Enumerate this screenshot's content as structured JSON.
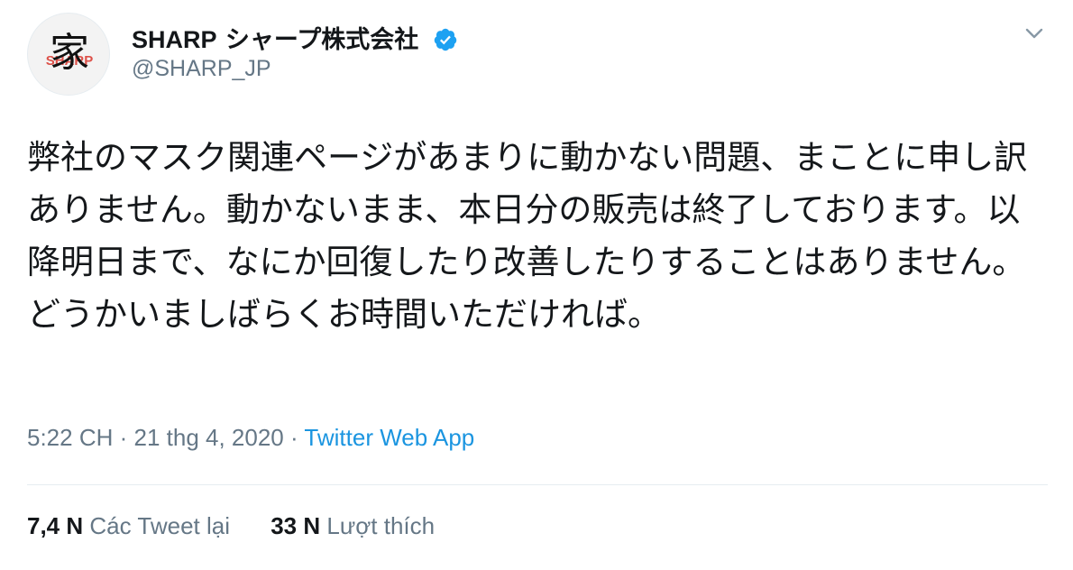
{
  "profile": {
    "display_name_latin": "SHARP",
    "display_name_jp": " シャープ株式会社",
    "handle": "@SHARP_JP",
    "avatar_kanji": "家",
    "avatar_brand": "SHARP",
    "verified": true,
    "verified_color": "#1da1f2"
  },
  "tweet": {
    "text": "弊社のマスク関連ページがあまりに動かない問題、まことに申し訳ありません。動かないまま、本日分の販売は終了しております。以降明日まで、なにか回復したり改善したりすることはありません。どうかいましばらくお時間いただければ。",
    "time": "5:22 CH",
    "separator": " · ",
    "date": "21 thg 4, 2020",
    "source": "Twitter Web App"
  },
  "stats": {
    "retweets_count": "7,4 N",
    "retweets_label": "Các Tweet lại",
    "likes_count": "33 N",
    "likes_label": "Lượt thích"
  },
  "icons": {
    "verified": "verified-badge-icon",
    "more": "chevron-down-icon"
  },
  "colors": {
    "text": "#14171a",
    "secondary": "#657786",
    "link": "#1b95e0"
  }
}
